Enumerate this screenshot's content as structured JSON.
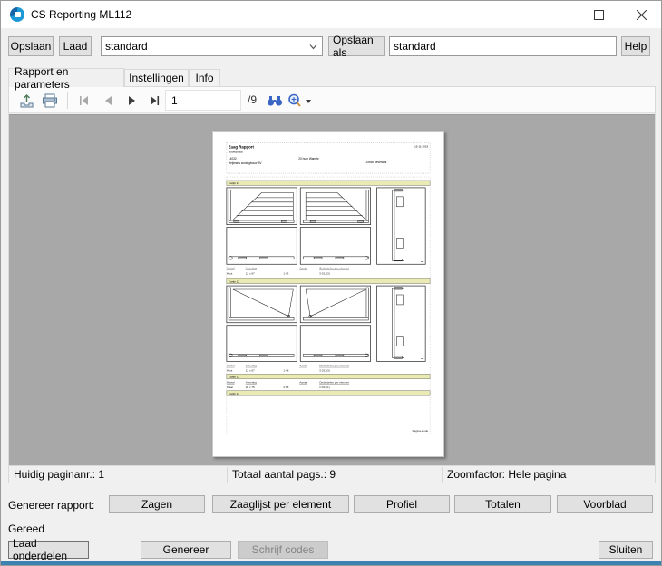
{
  "window": {
    "title": "CS Reporting ML112"
  },
  "toolbar": {
    "save": "Opslaan",
    "load": "Laad",
    "profile": "standard",
    "save_as": "Opslaan als",
    "save_as_value": "standard",
    "help": "Help"
  },
  "tabs": {
    "items": [
      {
        "label": "Rapport en parameters"
      },
      {
        "label": "Instellingen"
      },
      {
        "label": "Info"
      }
    ]
  },
  "preview": {
    "page_number": "1",
    "page_total": "/9",
    "status": {
      "current_page": "Huidig paginanr.: 1",
      "total_pages": "Totaal aantal pags.: 9",
      "zoom": "Zoomfactor: Hele pagina"
    }
  },
  "report_page": {
    "title": "Zaag Rapport",
    "date": "15-11-2019",
    "line2": "Bouwstraat",
    "order_no": "14032",
    "project": "20 huur Warmte",
    "customer": "Heijmans woningbouw BV",
    "contact": "Jorick Beverwijk",
    "bars": [
      {
        "label": "Kozijn 11"
      },
      {
        "label": "Kozijn 12"
      },
      {
        "label": "Kozijn 13"
      },
      {
        "label": "Kozijn 14"
      }
    ],
    "tables": [
      {
        "headers": [
          "Aantal",
          "Afmeting",
          "Aantal",
          "Onderdelen per element"
        ],
        "row": [
          "Hout",
          "12 x 67",
          "1:43",
          "3  D11(3)"
        ]
      },
      {
        "headers": [
          "Aantal",
          "Afmeting",
          "Aantal",
          "Onderdelen per element"
        ],
        "row": [
          "Hout",
          "12 x 67",
          "1:48",
          "3  D11(3)"
        ]
      },
      {
        "headers": [
          "Aantal",
          "Afmeting",
          "Aantal",
          "Onderdelen per element"
        ],
        "row": [
          "Staal",
          "26 x 75",
          "2:18",
          "1  D11(1)"
        ]
      }
    ],
    "page_end": "Pagina-einde"
  },
  "generate": {
    "label": "Genereer rapport:",
    "buttons": [
      {
        "label": "Zagen"
      },
      {
        "label": "Zaaglijst per element"
      },
      {
        "label": "Profiel"
      },
      {
        "label": "Totalen"
      },
      {
        "label": "Voorblad"
      }
    ]
  },
  "status_message": "Gereed",
  "actions": {
    "load_parts": "Laad onderdelen",
    "generate": "Genereer",
    "write_codes": "Schrijf codes",
    "close": "Sluiten"
  },
  "colors": {
    "titlebar_bg": "#ffffff",
    "window_bg": "#f0f0f0",
    "preview_bg": "#a8a8a8",
    "icon_blue": "#1d9ad6",
    "bar_yellow": "#eaeab4",
    "bottom_strip": "#3b82b0"
  }
}
